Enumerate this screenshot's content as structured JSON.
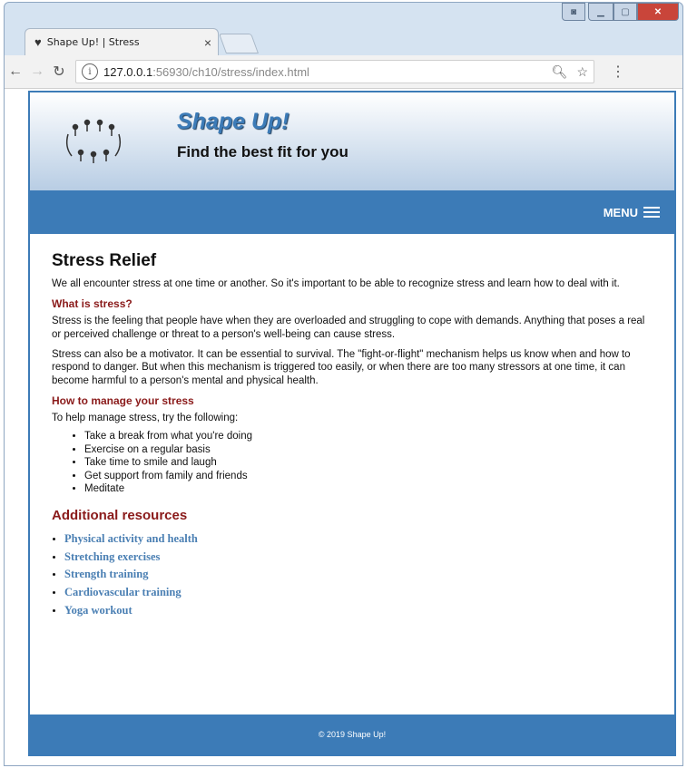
{
  "browser": {
    "tab_title": "Shape Up! | Stress",
    "tab_close": "×",
    "url_host": "127.0.0.1",
    "url_rest": ":56930/ch10/stress/index.html"
  },
  "site": {
    "title": "Shape Up!",
    "tagline": "Find the best fit for you",
    "menu_label": "MENU"
  },
  "article": {
    "heading": "Stress Relief",
    "intro": "We all encounter stress at one time or another. So it's important to be able to recognize stress and learn how to deal with it.",
    "what_heading": "What is stress?",
    "what_p1": "Stress is the feeling that people have when they are overloaded and struggling to cope with demands. Anything that poses a real or perceived challenge or threat to a person's well-being can cause stress.",
    "what_p2": "Stress can also be a motivator. It can be essential to survival. The \"fight-or-flight\" mechanism helps us know when and how to respond to danger. But when this mechanism is triggered too easily, or when there are too many stressors at one time, it can become harmful to a person's mental and physical health.",
    "manage_heading": "How to manage your stress",
    "manage_intro": "To help manage stress, try the following:",
    "tips": [
      "Take a break from what you're doing",
      "Exercise on a regular basis",
      "Take time to smile and laugh",
      "Get support from family and friends",
      "Meditate"
    ],
    "resources_heading": "Additional resources",
    "resources": [
      "Physical activity and health",
      "Stretching exercises",
      "Strength training",
      "Cardiovascular training",
      "Yoga workout"
    ]
  },
  "footer": {
    "text": "© 2019 Shape Up!"
  }
}
